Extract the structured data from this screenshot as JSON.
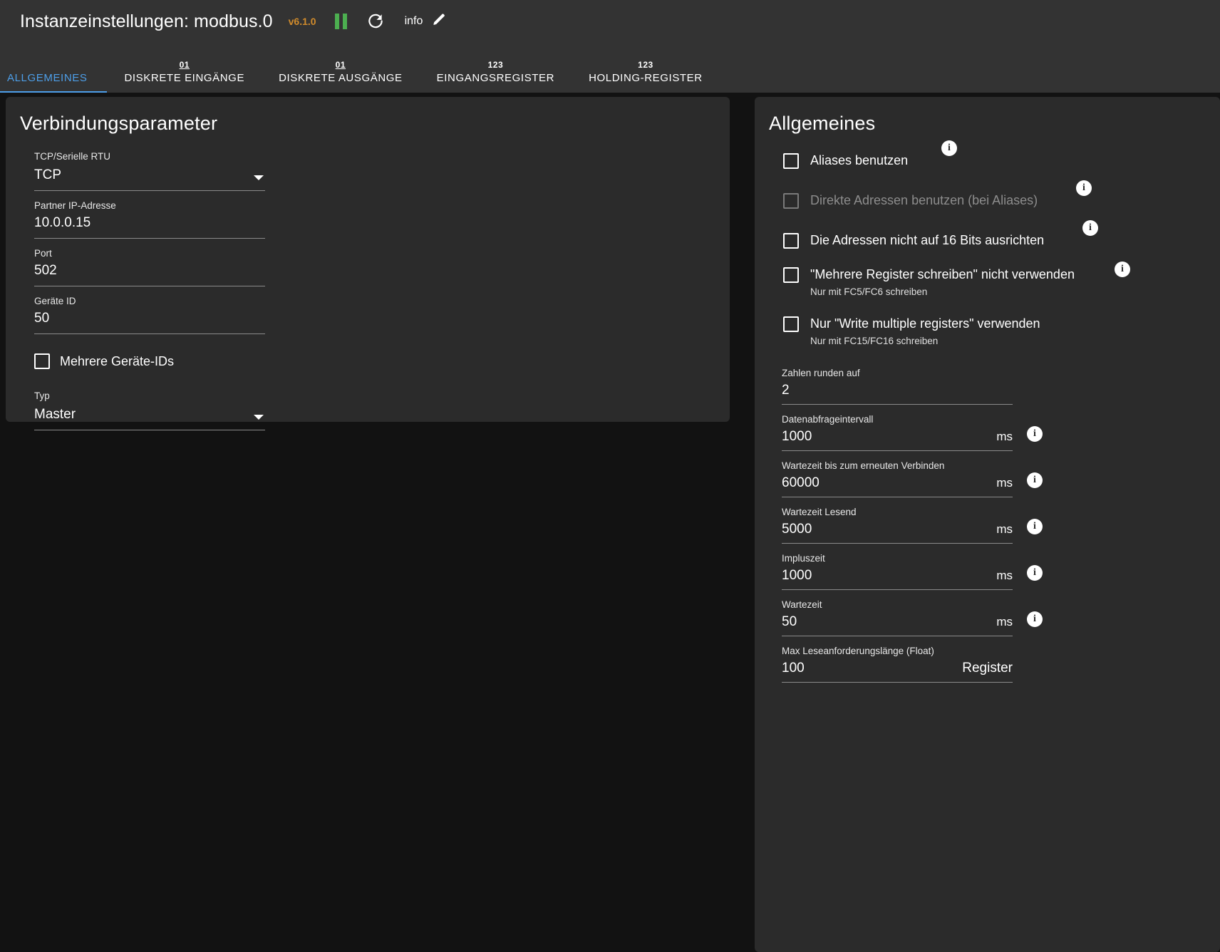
{
  "header": {
    "title": "Instanzeinstellungen: modbus.0",
    "version": "v6.1.0",
    "pause_icon": "pause-icon",
    "refresh_icon": "refresh-icon",
    "info_label": "info",
    "edit_icon": "pencil-icon"
  },
  "tabs": [
    {
      "label": "ALLGEMEINES",
      "icon": "",
      "active": true
    },
    {
      "label": "DISKRETE EINGÄNGE",
      "icon": "01",
      "active": false
    },
    {
      "label": "DISKRETE AUSGÄNGE",
      "icon": "01",
      "active": false
    },
    {
      "label": "EINGANGSREGISTER",
      "icon": "123",
      "active": false
    },
    {
      "label": "HOLDING-REGISTER",
      "icon": "123",
      "active": false
    }
  ],
  "left_panel": {
    "title": "Verbindungsparameter",
    "connection_type": {
      "label": "TCP/Serielle RTU",
      "value": "TCP"
    },
    "partner_ip": {
      "label": "Partner IP-Adresse",
      "value": "10.0.0.15"
    },
    "port": {
      "label": "Port",
      "value": "502"
    },
    "device_id": {
      "label": "Geräte ID",
      "value": "50"
    },
    "multi_device_ids": {
      "label": "Mehrere Geräte-IDs",
      "checked": false
    },
    "type": {
      "label": "Typ",
      "value": "Master"
    }
  },
  "right_panel": {
    "title": "Allgemeines",
    "checkboxes": [
      {
        "label": "Aliases benutzen",
        "sub": "",
        "checked": false,
        "disabled": false,
        "info": true
      },
      {
        "label": "Direkte Adressen benutzen (bei Aliases)",
        "sub": "",
        "checked": false,
        "disabled": true,
        "info": true
      },
      {
        "label": "Die Adressen nicht auf 16 Bits ausrichten",
        "sub": "",
        "checked": false,
        "disabled": false,
        "info": true
      },
      {
        "label": "\"Mehrere Register schreiben\" nicht verwenden",
        "sub": "Nur mit FC5/FC6 schreiben",
        "checked": false,
        "disabled": false,
        "info": true
      },
      {
        "label": "Nur \"Write multiple registers\" verwenden",
        "sub": "Nur mit FC15/FC16 schreiben",
        "checked": false,
        "disabled": false,
        "info": false
      }
    ],
    "fields": [
      {
        "label": "Zahlen runden auf",
        "value": "2",
        "unit": "",
        "info": false
      },
      {
        "label": "Datenabfrageintervall",
        "value": "1000",
        "unit": "ms",
        "info": true
      },
      {
        "label": "Wartezeit bis zum erneuten Verbinden",
        "value": "60000",
        "unit": "ms",
        "info": true
      },
      {
        "label": "Wartezeit Lesend",
        "value": "5000",
        "unit": "ms",
        "info": true
      },
      {
        "label": "Impluszeit",
        "value": "1000",
        "unit": "ms",
        "info": true
      },
      {
        "label": "Wartezeit",
        "value": "50",
        "unit": "ms",
        "info": true
      },
      {
        "label": "Max Leseanforderungslänge (Float)",
        "value": "100",
        "unit": "Register",
        "info": false
      }
    ]
  },
  "colors": {
    "accent": "#4d9ee8",
    "version": "#d08b2c",
    "pause": "#4caf50",
    "panel_bg": "#2b2b2b",
    "page_bg": "#121212",
    "header_bg": "#333333"
  }
}
